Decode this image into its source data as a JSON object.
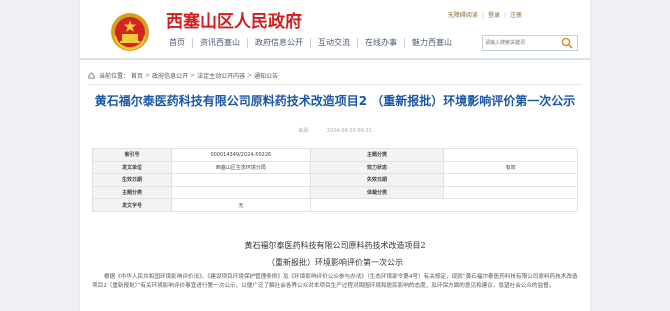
{
  "header": {
    "site_title": "西塞山区人民政府",
    "top_links": [
      "无障碍阅读",
      "登录",
      "注册"
    ],
    "nav": [
      "首页",
      "资讯西塞山",
      "政府信息公开",
      "互动交流",
      "在线办事",
      "魅力西塞山"
    ],
    "search_placeholder": "请输入搜索关键词"
  },
  "breadcrumb": {
    "prefix": "当前位置：",
    "items": [
      "首页",
      "政府信息公开",
      "法定主动公开内容",
      "通知公告"
    ]
  },
  "document": {
    "title": "黄石福尔泰医药科技有限公司原料药技术改造项目2 （重新报批）环境影响评价第一次公示",
    "source_label": "来源：",
    "source_value": "",
    "date": "2024-08-20 09:31"
  },
  "info_table": {
    "rows": [
      {
        "k1": "索引号",
        "v1": "000014349/2024-50226",
        "k2": "主题分类",
        "v2": ""
      },
      {
        "k1": "发文单位",
        "v1": "西塞山区生态环境分局",
        "k2": "效力状态",
        "v2": "有效"
      },
      {
        "k1": "生效日期",
        "v1": "",
        "k2": "失效日期",
        "v2": ""
      },
      {
        "k1": "主题分类",
        "v1": "",
        "k2": "体裁分类",
        "v2": ""
      },
      {
        "k1": "发文字号",
        "v1": "无",
        "k2": "",
        "v2": ""
      }
    ]
  },
  "body": {
    "title_line1": "黄石福尔泰医药科技有限公司原料药技术改造项目2",
    "title_line2": "（重新报批）环境影响评价第一次公示",
    "paragraph": "根据《中华人民共和国环境影响评价法》、《建设项目环境保护管理条例》及《环境影响评价公众参与办法》（生态环境部令第4号）有关规定，现就“黄石福尔泰医药科技有限公司原料药技术改造项目2（重新报批）”有关环境影响评价事宜进行第一次公示，以便广泛了解社会各界公众对本项目生产过程对周围环境和居民影响的态度，及环保方面的意见和建议，恳望社会公众的监督。"
  },
  "colors": {
    "site_title": "#d21e1e",
    "doc_title": "#1a57a8",
    "nav_text": "#4a5a7a"
  }
}
